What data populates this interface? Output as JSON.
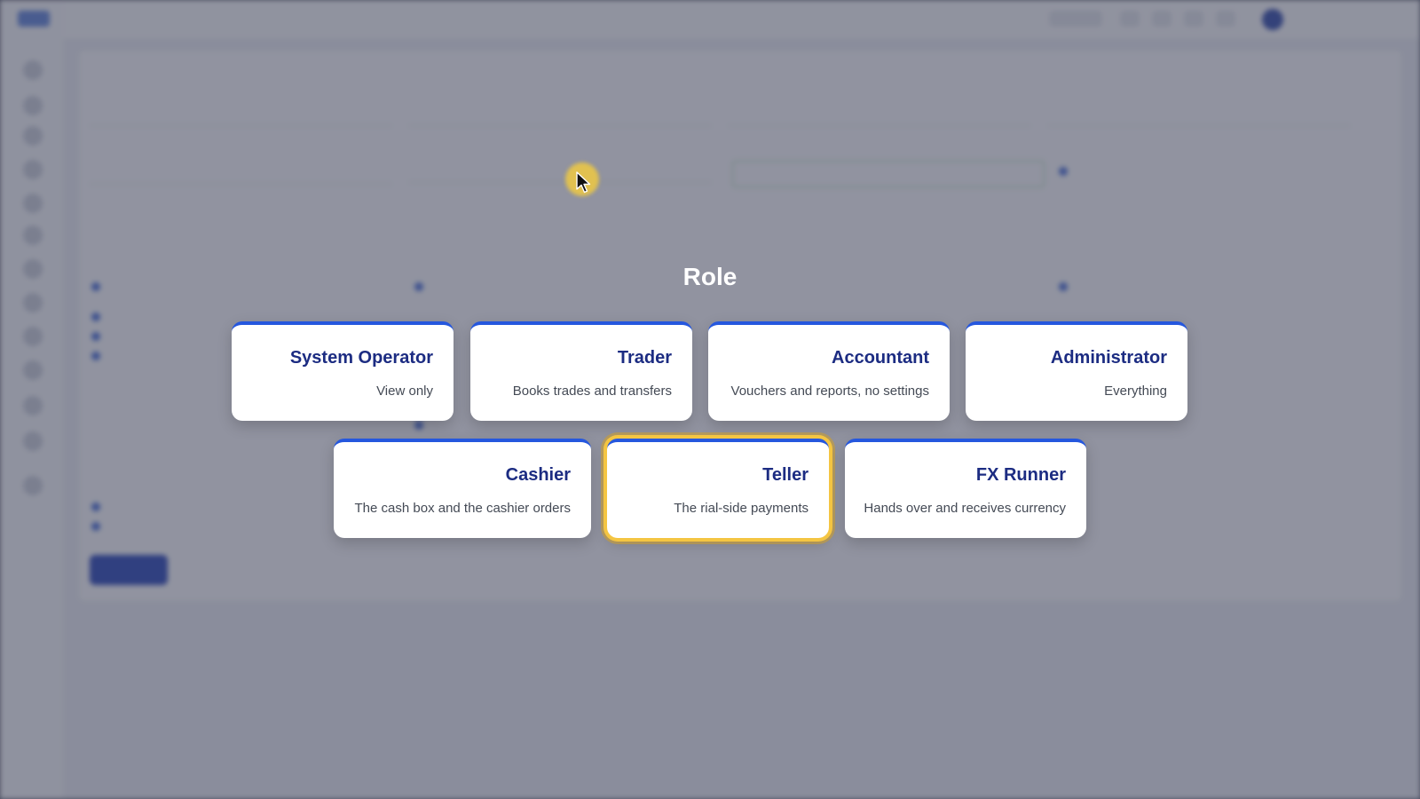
{
  "modal": {
    "title": "Role",
    "roles": [
      {
        "name": "System Operator",
        "desc": "View only"
      },
      {
        "name": "Trader",
        "desc": "Books trades and transfers"
      },
      {
        "name": "Accountant",
        "desc": "Vouchers and reports, no settings"
      },
      {
        "name": "Administrator",
        "desc": "Everything"
      },
      {
        "name": "Cashier",
        "desc": "The cash box and the cashier orders"
      },
      {
        "name": "Teller",
        "desc": "The rial-side payments",
        "selected": true
      },
      {
        "name": "FX Runner",
        "desc": "Hands over and receives currency"
      }
    ]
  },
  "colors": {
    "accent": "#2557de",
    "title_text": "#1c2c82",
    "selection_ring": "#f4c542",
    "overlay": "#3c4054"
  }
}
